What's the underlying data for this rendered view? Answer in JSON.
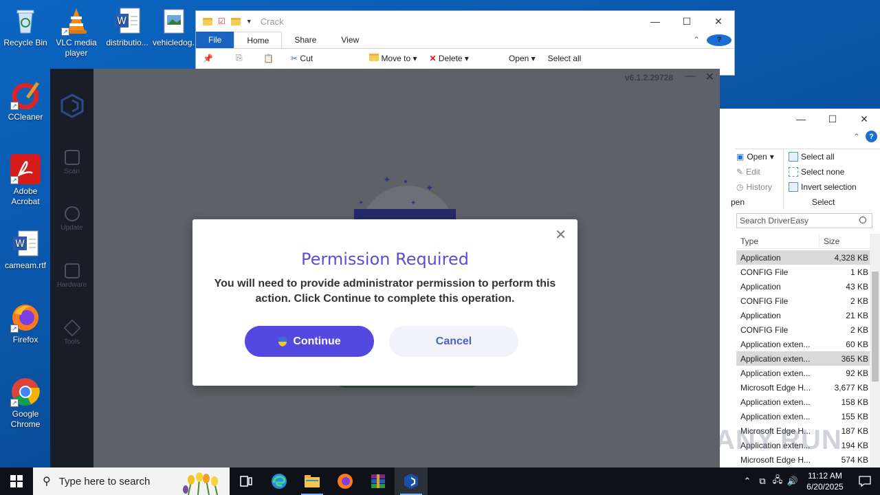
{
  "desktop": {
    "icons": [
      {
        "label": "Recycle Bin",
        "icon": "recycle-bin-icon"
      },
      {
        "label": "VLC media player",
        "icon": "vlc-icon"
      },
      {
        "label": "distributio...",
        "icon": "word-doc-icon"
      },
      {
        "label": "vehicledog...",
        "icon": "image-file-icon"
      },
      {
        "label": "CCleaner",
        "icon": "ccleaner-icon"
      },
      {
        "label": "Adobe Acrobat",
        "icon": "acrobat-icon"
      },
      {
        "label": "cameam.rtf",
        "icon": "word-doc-icon"
      },
      {
        "label": "Firefox",
        "icon": "firefox-icon"
      },
      {
        "label": "Google Chrome",
        "icon": "chrome-icon"
      }
    ]
  },
  "explorer": {
    "title": "Crack",
    "tabs": [
      "File",
      "Home",
      "Share",
      "View"
    ],
    "ribbon": {
      "cut": "Cut",
      "move_to": "Move to",
      "delete": "Delete",
      "open": "Open",
      "select_all": "Select all"
    }
  },
  "explorer2": {
    "ribbon": {
      "open": "Open",
      "edit": "Edit",
      "history": "History",
      "open_group": "pen",
      "select_all": "Select all",
      "select_none": "Select none",
      "invert_selection": "Invert selection",
      "select_group": "Select"
    },
    "search_placeholder": "Search DriverEasy",
    "columns": [
      "Type",
      "Size"
    ],
    "files": [
      {
        "type": "Application",
        "size": "4,328 KB",
        "selected": true
      },
      {
        "type": "CONFIG File",
        "size": "1 KB",
        "selected": false
      },
      {
        "type": "Application",
        "size": "43 KB",
        "selected": false
      },
      {
        "type": "CONFIG File",
        "size": "2 KB",
        "selected": false
      },
      {
        "type": "Application",
        "size": "21 KB",
        "selected": false
      },
      {
        "type": "CONFIG File",
        "size": "2 KB",
        "selected": false
      },
      {
        "type": "Application exten...",
        "size": "60 KB",
        "selected": false
      },
      {
        "type": "Application exten...",
        "size": "365 KB",
        "selected": true
      },
      {
        "type": "Application exten...",
        "size": "92 KB",
        "selected": false
      },
      {
        "type": "Microsoft Edge H...",
        "size": "3,677 KB",
        "selected": false
      },
      {
        "type": "Application exten...",
        "size": "158 KB",
        "selected": false
      },
      {
        "type": "Application exten...",
        "size": "155 KB",
        "selected": false
      },
      {
        "type": "Microsoft Edge H...",
        "size": "187 KB",
        "selected": false
      },
      {
        "type": "Application exten...",
        "size": "194 KB",
        "selected": false
      },
      {
        "type": "Microsoft Edge H...",
        "size": "574 KB",
        "selected": false
      }
    ],
    "watermark": "ANY.RUN"
  },
  "drivereasy": {
    "version": "v6.1.2.29728",
    "nav": [
      "Scan",
      "Update",
      "Hardware",
      "Tools"
    ]
  },
  "dialog": {
    "title": "Permission Required",
    "message": "You will need to provide administrator permission to perform this action. Click Continue to complete this operation.",
    "continue_label": "Continue",
    "cancel_label": "Cancel",
    "accent": "#5348e0"
  },
  "taskbar": {
    "search_placeholder": "Type here to search",
    "time": "11:12 AM",
    "date": "6/20/2025"
  }
}
